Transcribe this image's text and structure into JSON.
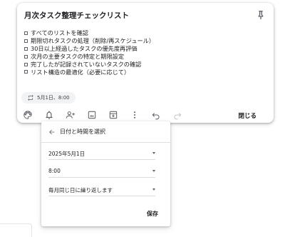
{
  "note": {
    "title": "月次タスク整理チェックリスト",
    "checklist": [
      "すべてのリストを確認",
      "期限切れタスクの処理（削除/再スケジュール）",
      "30日以上経過したタスクの優先度再評価",
      "次月の主要タスクの特定と期限設定",
      "完了したが記録されていないタスクの確認",
      "リスト構造の最適化（必要に応じて）"
    ],
    "reminder_chip": "5月1日、8:00",
    "close_label": "閉じる"
  },
  "toolbar": {
    "icons": [
      "palette-icon",
      "reminder-bell-icon",
      "collaborator-icon",
      "image-icon",
      "archive-icon",
      "more-vert-icon",
      "undo-icon",
      "redo-icon"
    ]
  },
  "reminder_popup": {
    "title": "日付と時間を選択",
    "date_value": "2025年5月1日",
    "time_value": "8:00",
    "repeat_value": "毎月同じ日に繰り返します",
    "save_label": "保存"
  },
  "colors": {
    "text": "#202124",
    "icon": "#5f6368",
    "chip_bg": "#f1f3f4",
    "divider": "#e0e0e0"
  }
}
